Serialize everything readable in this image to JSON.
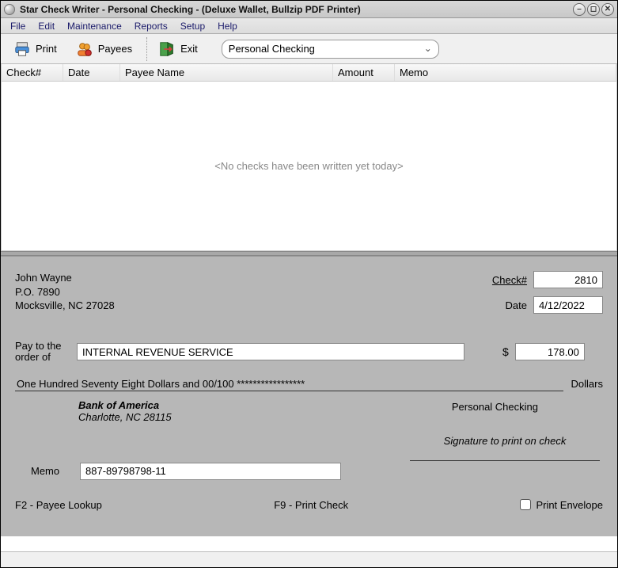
{
  "title": "Star Check Writer - Personal Checking - (Deluxe Wallet, Bullzip PDF Printer)",
  "menu": {
    "file": "File",
    "edit": "Edit",
    "maint": "Maintenance",
    "reports": "Reports",
    "setup": "Setup",
    "help": "Help"
  },
  "toolbar": {
    "print": "Print",
    "payees": "Payees",
    "exit": "Exit",
    "account": "Personal Checking"
  },
  "grid": {
    "cols": {
      "check": "Check#",
      "date": "Date",
      "payee": "Payee Name",
      "amount": "Amount",
      "memo": "Memo"
    },
    "empty": "<No checks have been written yet today>"
  },
  "check": {
    "payer_name": "John Wayne",
    "payer_addr1": "P.O. 7890",
    "payer_addr2": "Mocksville, NC  27028",
    "checknum_label": "Check#",
    "checknum": "2810",
    "date_label": "Date",
    "date": "4/12/2022",
    "payto_label1": "Pay to the",
    "payto_label2": "order of",
    "payee": "INTERNAL REVENUE SERVICE",
    "dollar_sign": "$",
    "amount": "178.00",
    "amount_words": "One Hundred Seventy Eight Dollars and 00/100 *****************",
    "dollars_label": "Dollars",
    "bank_name": "Bank of America",
    "bank_city": "Charlotte, NC 28115",
    "account_name": "Personal Checking",
    "signature_hint": "Signature to print on check",
    "memo_label": "Memo",
    "memo": "887-89798798-11",
    "f2": "F2 - Payee Lookup",
    "f9": "F9 - Print Check",
    "print_env": "Print Envelope"
  }
}
